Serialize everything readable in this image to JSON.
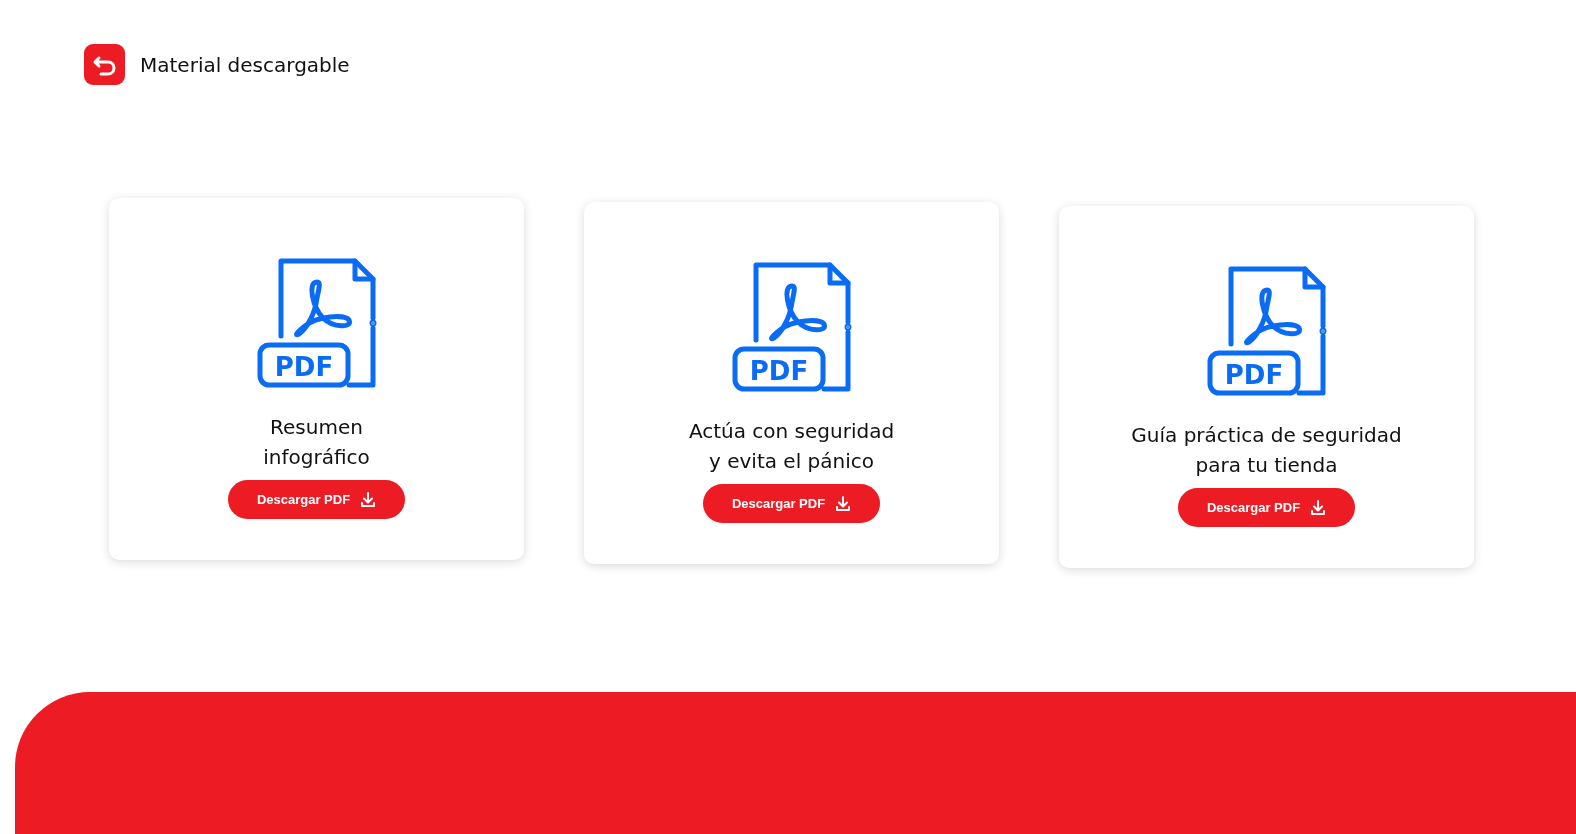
{
  "header": {
    "title": "Material descargable"
  },
  "cards": [
    {
      "badge": "PDF",
      "title_lines": [
        "Resumen",
        "infográfico"
      ],
      "button": "Descargar PDF"
    },
    {
      "badge": "PDF",
      "title_lines": [
        "Actúa con seguridad",
        "y evita el pánico"
      ],
      "button": "Descargar PDF"
    },
    {
      "badge": "PDF",
      "title_lines": [
        "Guía práctica de seguridad",
        "para tu tienda"
      ],
      "button": "Descargar PDF"
    }
  ]
}
